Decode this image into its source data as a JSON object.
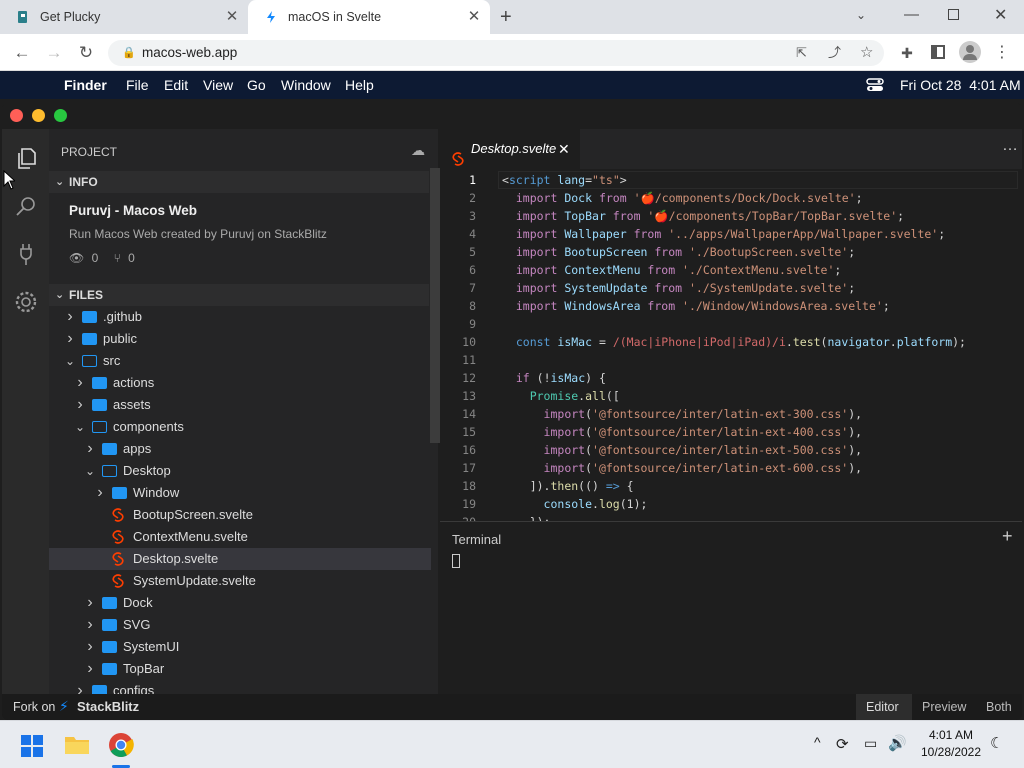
{
  "browser": {
    "tabs": [
      {
        "title": "Get Plucky",
        "active": false
      },
      {
        "title": "macOS in Svelte",
        "active": true
      }
    ],
    "url": "macos-web.app"
  },
  "menubar": {
    "items": [
      "Finder",
      "File",
      "Edit",
      "View",
      "Go",
      "Window",
      "Help"
    ],
    "datetime": "Fri Oct 28  4:01 AM"
  },
  "sidebar": {
    "project_label": "PROJECT",
    "info_label": "INFO",
    "project_name": "Puruvj - Macos Web",
    "project_desc": "Run Macos Web created by Puruvj on StackBlitz",
    "views": "0",
    "forks": "0",
    "files_label": "FILES",
    "tree": [
      {
        "name": ".github",
        "type": "folder",
        "depth": 0,
        "open": false
      },
      {
        "name": "public",
        "type": "folder",
        "depth": 0,
        "open": false
      },
      {
        "name": "src",
        "type": "folder",
        "depth": 0,
        "open": true
      },
      {
        "name": "actions",
        "type": "folder",
        "depth": 1,
        "open": false
      },
      {
        "name": "assets",
        "type": "folder",
        "depth": 1,
        "open": false
      },
      {
        "name": "components",
        "type": "folder",
        "depth": 1,
        "open": true
      },
      {
        "name": "apps",
        "type": "folder",
        "depth": 2,
        "open": false
      },
      {
        "name": "Desktop",
        "type": "folder",
        "depth": 2,
        "open": true
      },
      {
        "name": "Window",
        "type": "folder",
        "depth": 3,
        "open": false
      },
      {
        "name": "BootupScreen.svelte",
        "type": "svelte",
        "depth": 3
      },
      {
        "name": "ContextMenu.svelte",
        "type": "svelte",
        "depth": 3
      },
      {
        "name": "Desktop.svelte",
        "type": "svelte",
        "depth": 3,
        "selected": true
      },
      {
        "name": "SystemUpdate.svelte",
        "type": "svelte",
        "depth": 3
      },
      {
        "name": "Dock",
        "type": "folder",
        "depth": 2,
        "open": false
      },
      {
        "name": "SVG",
        "type": "folder",
        "depth": 2,
        "open": false
      },
      {
        "name": "SystemUI",
        "type": "folder",
        "depth": 2,
        "open": false
      },
      {
        "name": "TopBar",
        "type": "folder",
        "depth": 2,
        "open": false
      },
      {
        "name": "configs",
        "type": "folder",
        "depth": 1,
        "open": false
      }
    ]
  },
  "editor": {
    "tab_name": "Desktop.svelte",
    "more": "…",
    "lines": [
      [
        [
          "pu",
          "<"
        ],
        [
          "kb",
          "script "
        ],
        [
          "id",
          "lang"
        ],
        [
          "pu",
          "="
        ],
        [
          "st",
          "\"ts\""
        ],
        [
          "pu",
          ">"
        ]
      ],
      [
        [
          "pu",
          "  "
        ],
        [
          "kw",
          "import "
        ],
        [
          "id",
          "Dock "
        ],
        [
          "kw",
          "from "
        ],
        [
          "st",
          "'🍎/components/Dock/Dock.svelte'"
        ],
        [
          "pu",
          ";"
        ]
      ],
      [
        [
          "pu",
          "  "
        ],
        [
          "kw",
          "import "
        ],
        [
          "id",
          "TopBar "
        ],
        [
          "kw",
          "from "
        ],
        [
          "st",
          "'🍎/components/TopBar/TopBar.svelte'"
        ],
        [
          "pu",
          ";"
        ]
      ],
      [
        [
          "pu",
          "  "
        ],
        [
          "kw",
          "import "
        ],
        [
          "id",
          "Wallpaper "
        ],
        [
          "kw",
          "from "
        ],
        [
          "st",
          "'../apps/WallpaperApp/Wallpaper.svelte'"
        ],
        [
          "pu",
          ";"
        ]
      ],
      [
        [
          "pu",
          "  "
        ],
        [
          "kw",
          "import "
        ],
        [
          "id",
          "BootupScreen "
        ],
        [
          "kw",
          "from "
        ],
        [
          "st",
          "'./BootupScreen.svelte'"
        ],
        [
          "pu",
          ";"
        ]
      ],
      [
        [
          "pu",
          "  "
        ],
        [
          "kw",
          "import "
        ],
        [
          "id",
          "ContextMenu "
        ],
        [
          "kw",
          "from "
        ],
        [
          "st",
          "'./ContextMenu.svelte'"
        ],
        [
          "pu",
          ";"
        ]
      ],
      [
        [
          "pu",
          "  "
        ],
        [
          "kw",
          "import "
        ],
        [
          "id",
          "SystemUpdate "
        ],
        [
          "kw",
          "from "
        ],
        [
          "st",
          "'./SystemUpdate.svelte'"
        ],
        [
          "pu",
          ";"
        ]
      ],
      [
        [
          "pu",
          "  "
        ],
        [
          "kw",
          "import "
        ],
        [
          "id",
          "WindowsArea "
        ],
        [
          "kw",
          "from "
        ],
        [
          "st",
          "'./Window/WindowsArea.svelte'"
        ],
        [
          "pu",
          ";"
        ]
      ],
      [],
      [
        [
          "pu",
          "  "
        ],
        [
          "kb",
          "const "
        ],
        [
          "id",
          "isMac "
        ],
        [
          "pu",
          "= "
        ],
        [
          "rx",
          "/(Mac|iPhone|iPod|iPad)/i"
        ],
        [
          "pu",
          "."
        ],
        [
          "fn",
          "test"
        ],
        [
          "pu",
          "("
        ],
        [
          "id",
          "navigator"
        ],
        [
          "pu",
          "."
        ],
        [
          "id",
          "platform"
        ],
        [
          "pu",
          ");"
        ]
      ],
      [],
      [
        [
          "pu",
          "  "
        ],
        [
          "kw",
          "if "
        ],
        [
          "pu",
          "(!"
        ],
        [
          "id",
          "isMac"
        ],
        [
          "pu",
          ") {"
        ]
      ],
      [
        [
          "pu",
          "    "
        ],
        [
          "ty",
          "Promise"
        ],
        [
          "pu",
          "."
        ],
        [
          "fn",
          "all"
        ],
        [
          "pu",
          "(["
        ]
      ],
      [
        [
          "pu",
          "      "
        ],
        [
          "kw",
          "import"
        ],
        [
          "pu",
          "("
        ],
        [
          "st",
          "'@fontsource/inter/latin-ext-300.css'"
        ],
        [
          "pu",
          "),"
        ]
      ],
      [
        [
          "pu",
          "      "
        ],
        [
          "kw",
          "import"
        ],
        [
          "pu",
          "("
        ],
        [
          "st",
          "'@fontsource/inter/latin-ext-400.css'"
        ],
        [
          "pu",
          "),"
        ]
      ],
      [
        [
          "pu",
          "      "
        ],
        [
          "kw",
          "import"
        ],
        [
          "pu",
          "("
        ],
        [
          "st",
          "'@fontsource/inter/latin-ext-500.css'"
        ],
        [
          "pu",
          "),"
        ]
      ],
      [
        [
          "pu",
          "      "
        ],
        [
          "kw",
          "import"
        ],
        [
          "pu",
          "("
        ],
        [
          "st",
          "'@fontsource/inter/latin-ext-600.css'"
        ],
        [
          "pu",
          "),"
        ]
      ],
      [
        [
          "pu",
          "    ])."
        ],
        [
          "fn",
          "then"
        ],
        [
          "pu",
          "(() "
        ],
        [
          "kb",
          "=> "
        ],
        [
          "pu",
          "{"
        ]
      ],
      [
        [
          "pu",
          "      "
        ],
        [
          "id",
          "console"
        ],
        [
          "pu",
          "."
        ],
        [
          "fn",
          "log"
        ],
        [
          "pu",
          "(1);"
        ]
      ],
      [
        [
          "pu",
          "    });"
        ]
      ]
    ]
  },
  "terminal": {
    "label": "Terminal",
    "add": "+"
  },
  "statusbar": {
    "fork_on": "Fork on",
    "brand": "StackBlitz",
    "modes": [
      "Editor",
      "Preview",
      "Both"
    ],
    "active_mode": "Editor"
  },
  "taskbar": {
    "time": "4:01 AM",
    "date": "10/28/2022"
  },
  "colors": {
    "accent_folder": "#2196f3",
    "svelte": "#ff3e00",
    "menubar": "#0d1a33"
  }
}
